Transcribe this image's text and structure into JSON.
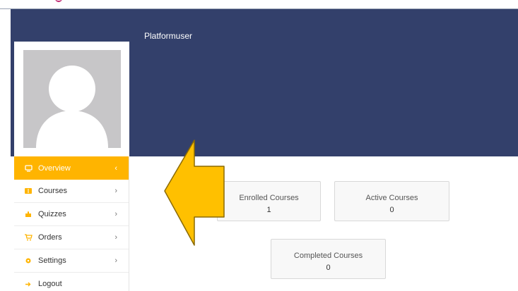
{
  "profile": {
    "username": "Platformuser"
  },
  "colors": {
    "banner": "#33406b",
    "accent": "#ffb400",
    "arrow_fill": "#ffc000",
    "arrow_stroke": "#8b6a00"
  },
  "menu": {
    "items": [
      {
        "label": "Overview",
        "icon": "dashboard-icon",
        "active": true
      },
      {
        "label": "Courses",
        "icon": "book-icon",
        "active": false
      },
      {
        "label": "Quizzes",
        "icon": "puzzle-icon",
        "active": false
      },
      {
        "label": "Orders",
        "icon": "cart-icon",
        "active": false
      },
      {
        "label": "Settings",
        "icon": "gear-icon",
        "active": false
      },
      {
        "label": "Logout",
        "icon": "logout-icon",
        "active": false
      }
    ]
  },
  "stats": {
    "enrolled": {
      "label": "Enrolled Courses",
      "value": "1"
    },
    "active": {
      "label": "Active Courses",
      "value": "0"
    },
    "completed": {
      "label": "Completed Courses",
      "value": "0"
    }
  }
}
